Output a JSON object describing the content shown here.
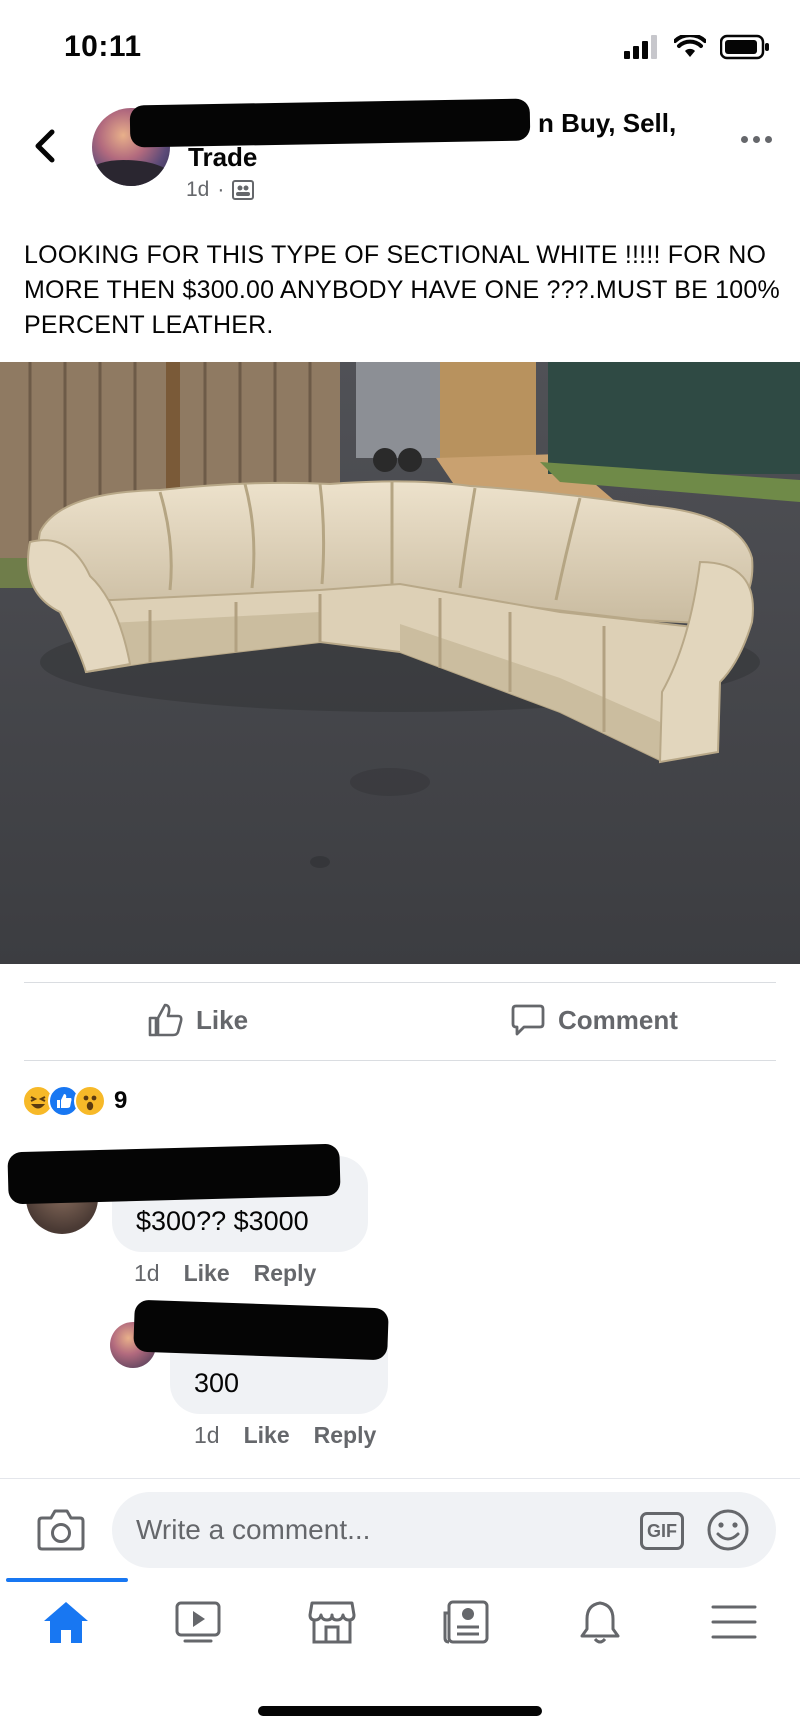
{
  "status_bar": {
    "time": "10:11"
  },
  "post": {
    "group_name_suffix": "n Buy, Sell,",
    "group_name_line2": "Trade",
    "time_ago": "1d",
    "separator": "·",
    "text": "LOOKING FOR THIS TYPE OF SECTIONAL WHITE !!!!! FOR NO MORE THEN $300.00 ANYBODY HAVE ONE ???.MUST BE 100% PERCENT LEATHER."
  },
  "actions": {
    "like_label": "Like",
    "comment_label": "Comment"
  },
  "reactions": {
    "icons": [
      "haha-icon",
      "like-icon",
      "wow-icon"
    ],
    "count": "9"
  },
  "comments": [
    {
      "text": "$300?? $3000",
      "time": "1d",
      "like_label": "Like",
      "reply_label": "Reply"
    },
    {
      "text": "300",
      "time": "1d",
      "like_label": "Like",
      "reply_label": "Reply"
    }
  ],
  "composer": {
    "placeholder": "Write a comment...",
    "gif_label": "GIF"
  },
  "tab_bar": {
    "items": [
      "home-icon",
      "watch-icon",
      "marketplace-icon",
      "news-icon",
      "notifications-icon",
      "menu-icon"
    ],
    "active": "home-icon"
  },
  "colors": {
    "accent": "#1877f2",
    "muted_text": "#65676b",
    "bubble": "#f0f2f5"
  }
}
